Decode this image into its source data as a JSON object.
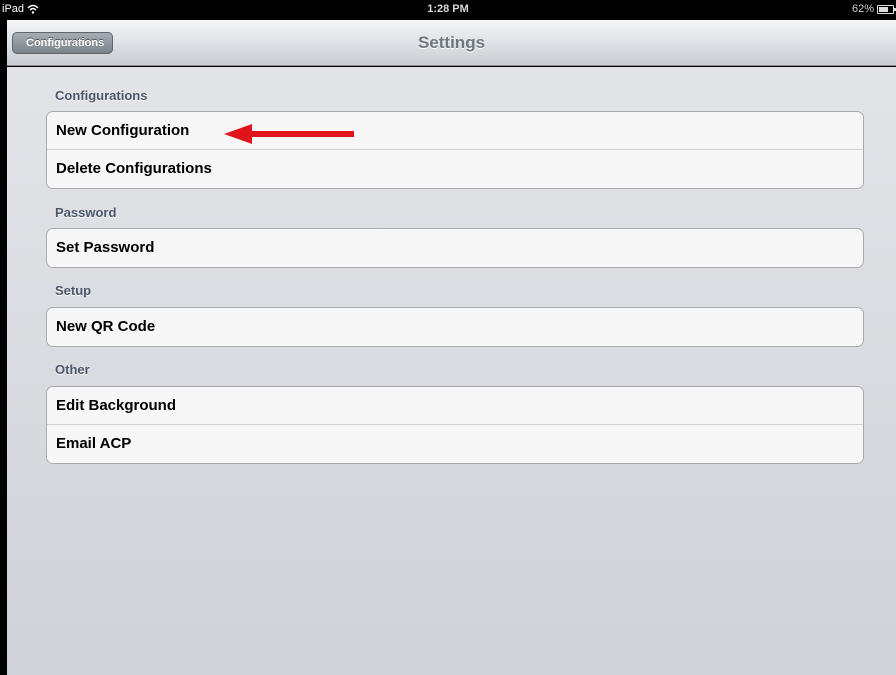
{
  "status_bar": {
    "carrier": "iPad",
    "wifi_icon": "wifi-icon",
    "time": "1:28 PM",
    "battery_percent": "62%",
    "battery_level": 0.62
  },
  "nav_bar": {
    "back_label": "Configurations",
    "title": "Settings"
  },
  "sections": {
    "configurations": {
      "header": "Configurations",
      "items": [
        "New Configuration",
        "Delete Configurations"
      ]
    },
    "password": {
      "header": "Password",
      "items": [
        "Set Password"
      ]
    },
    "setup": {
      "header": "Setup",
      "items": [
        "New QR Code"
      ]
    },
    "other": {
      "header": "Other",
      "items": [
        "Edit Background",
        "Email ACP"
      ]
    }
  },
  "annotation": {
    "arrow_color": "#e0151b",
    "points_to": "New Configuration"
  },
  "colors": {
    "section_header": "#4c566c",
    "nav_title": "#6f7780",
    "background": "#dadde1"
  }
}
